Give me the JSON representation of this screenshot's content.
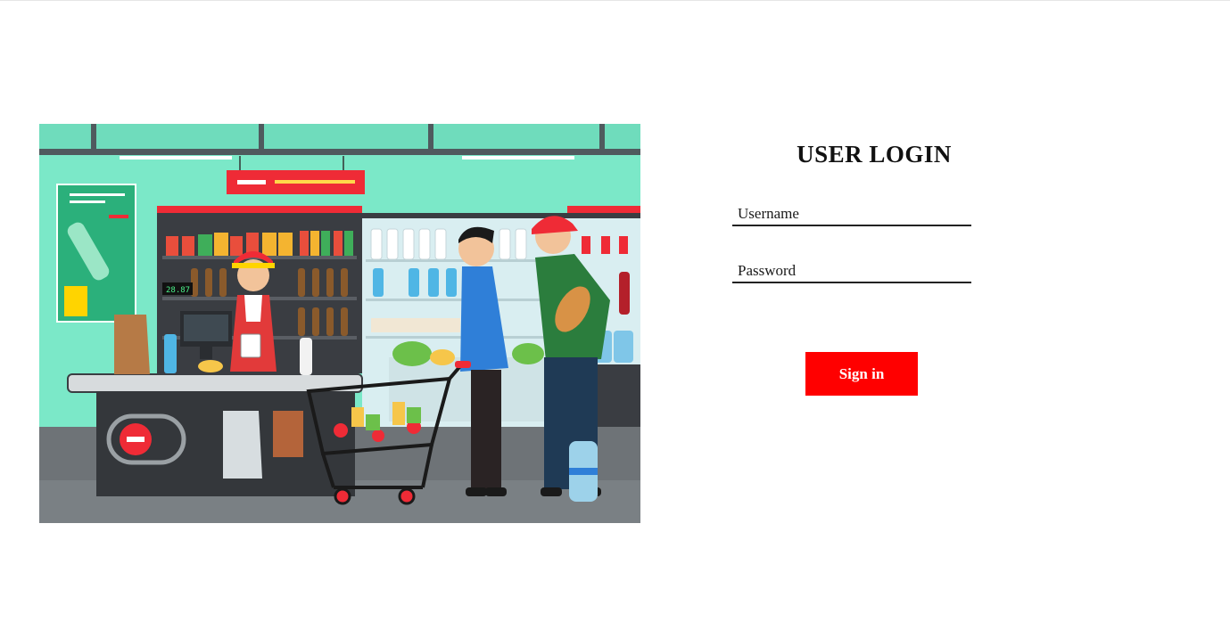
{
  "illustration": {
    "label": "Supermarket checkout illustration",
    "price_display": "28.87",
    "colors": {
      "wall": "#7be8c8",
      "shelf_dark": "#3a3d42",
      "accent_red": "#ef2b36",
      "floor": "#6e7377"
    }
  },
  "login": {
    "title": "USER LOGIN",
    "username_placeholder": "Username",
    "username_value": "",
    "password_placeholder": "Password",
    "password_value": "",
    "signin_label": "Sign in",
    "button_color": "#ff0000"
  }
}
